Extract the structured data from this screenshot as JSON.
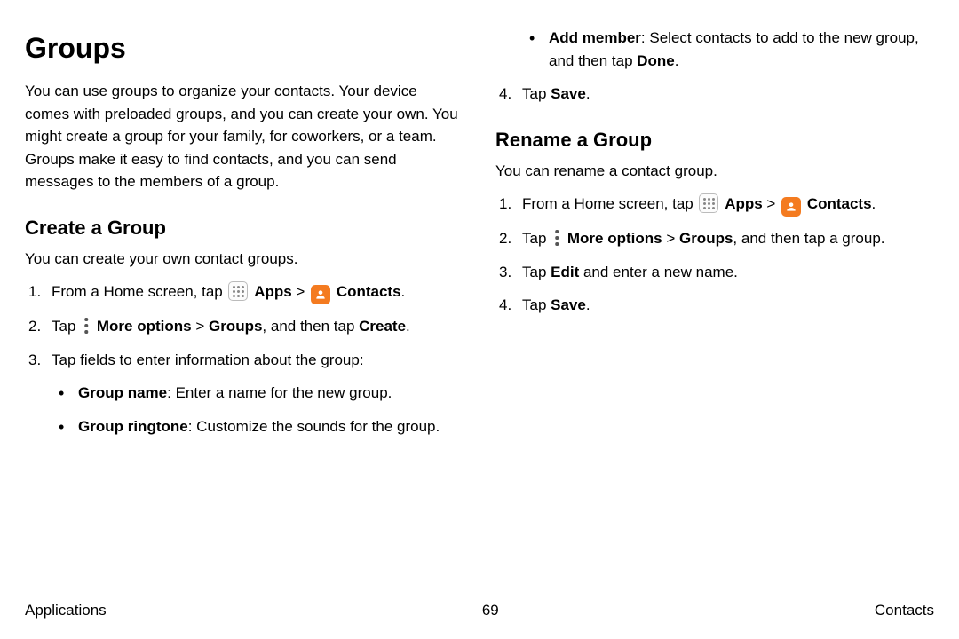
{
  "page": {
    "title": "Groups",
    "intro": "You can use groups to organize your contacts. Your device comes with preloaded groups, and you can create your own. You might create a group for your family, for coworkers, or a team. Groups make it easy to find contacts, and you can send messages to the members of a group."
  },
  "create": {
    "heading": "Create a Group",
    "lead": "You can create your own contact groups.",
    "step1": {
      "prefix": "From a Home screen, tap ",
      "apps": "Apps",
      "separator": " > ",
      "contacts": "Contacts",
      "suffix": "."
    },
    "step2": {
      "prefix": "Tap ",
      "more": "More options",
      "sep": " > ",
      "groups": "Groups",
      "mid": ", and then tap ",
      "create": "Create",
      "suffix": "."
    },
    "step3": "Tap fields to enter information about the group:",
    "sub_name_label": "Group name",
    "sub_name_text": ": Enter a name for the new group.",
    "sub_ringtone_label": "Group ringtone",
    "sub_ringtone_text": ": Customize the sounds for the group.",
    "sub_addmember_label": "Add member",
    "sub_addmember_text_a": ": Select contacts to add to the new group, and then tap ",
    "sub_addmember_text_b": "Done",
    "sub_addmember_text_c": ".",
    "step4_prefix": "Tap ",
    "step4_bold": "Save",
    "step4_suffix": "."
  },
  "rename": {
    "heading": "Rename a Group",
    "lead": "You can rename a contact group.",
    "step1": {
      "prefix": "From a Home screen, tap ",
      "apps": "Apps",
      "separator": " > ",
      "contacts": "Contacts",
      "suffix": "."
    },
    "step2": {
      "prefix": "Tap ",
      "more": "More options",
      "sep": " > ",
      "groups": "Groups",
      "suffix": ", and then tap a group."
    },
    "step3_prefix": "Tap ",
    "step3_bold": "Edit",
    "step3_suffix": " and enter a new name.",
    "step4_prefix": "Tap ",
    "step4_bold": "Save",
    "step4_suffix": "."
  },
  "footer": {
    "left": "Applications",
    "page": "69",
    "right": "Contacts"
  }
}
